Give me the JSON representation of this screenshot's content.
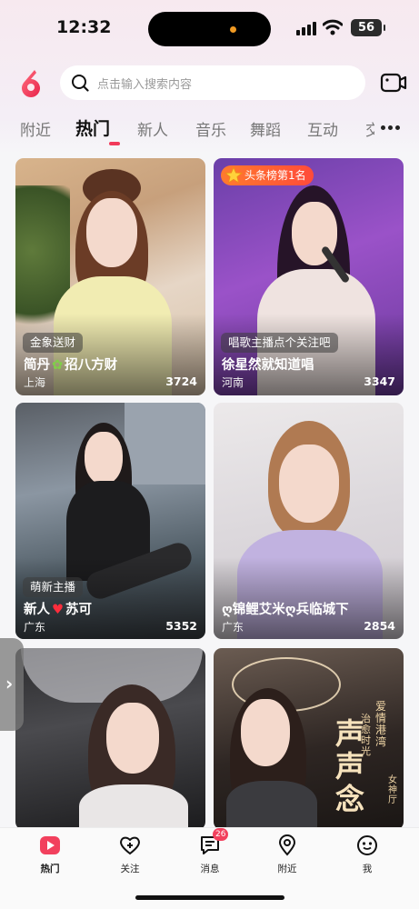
{
  "status_bar": {
    "time": "12:32",
    "battery": "56"
  },
  "search": {
    "placeholder": "点击输入搜索内容"
  },
  "tabs": [
    {
      "label": "附近"
    },
    {
      "label": "热门"
    },
    {
      "label": "新人"
    },
    {
      "label": "音乐"
    },
    {
      "label": "舞蹈"
    },
    {
      "label": "互动"
    },
    {
      "label": "交"
    }
  ],
  "active_tab": "热门",
  "cards": [
    {
      "tag": "金象送财",
      "title": "简丹",
      "title_suffix": "招八方财",
      "city": "上海",
      "count": "3724"
    },
    {
      "rank_badge": "头条榜第1名",
      "tag": "唱歌主播点个关注吧",
      "title": "徐星然就知道唱",
      "city": "河南",
      "count": "3347"
    },
    {
      "tag": "萌新主播",
      "title": "新人",
      "title_suffix": "苏可",
      "city": "广东",
      "count": "5352"
    },
    {
      "title": "ღ锦鲤艾米ღ兵临城下",
      "city": "广东",
      "count": "2854"
    },
    {},
    {
      "poster_big": "声声念",
      "poster_side_1": "爱情港湾",
      "poster_side_2": "治愈时光",
      "poster_side_3": "女神厅"
    }
  ],
  "bottom_nav": [
    {
      "label": "热门",
      "icon": "hot-icon",
      "active": true
    },
    {
      "label": "关注",
      "icon": "heart-plus-icon"
    },
    {
      "label": "消息",
      "icon": "message-icon",
      "badge": "26"
    },
    {
      "label": "附近",
      "icon": "location-icon"
    },
    {
      "label": "我",
      "icon": "profile-face-icon"
    }
  ],
  "colors": {
    "accent": "#f13a5a",
    "badge_orange": "#ff6a2e"
  }
}
